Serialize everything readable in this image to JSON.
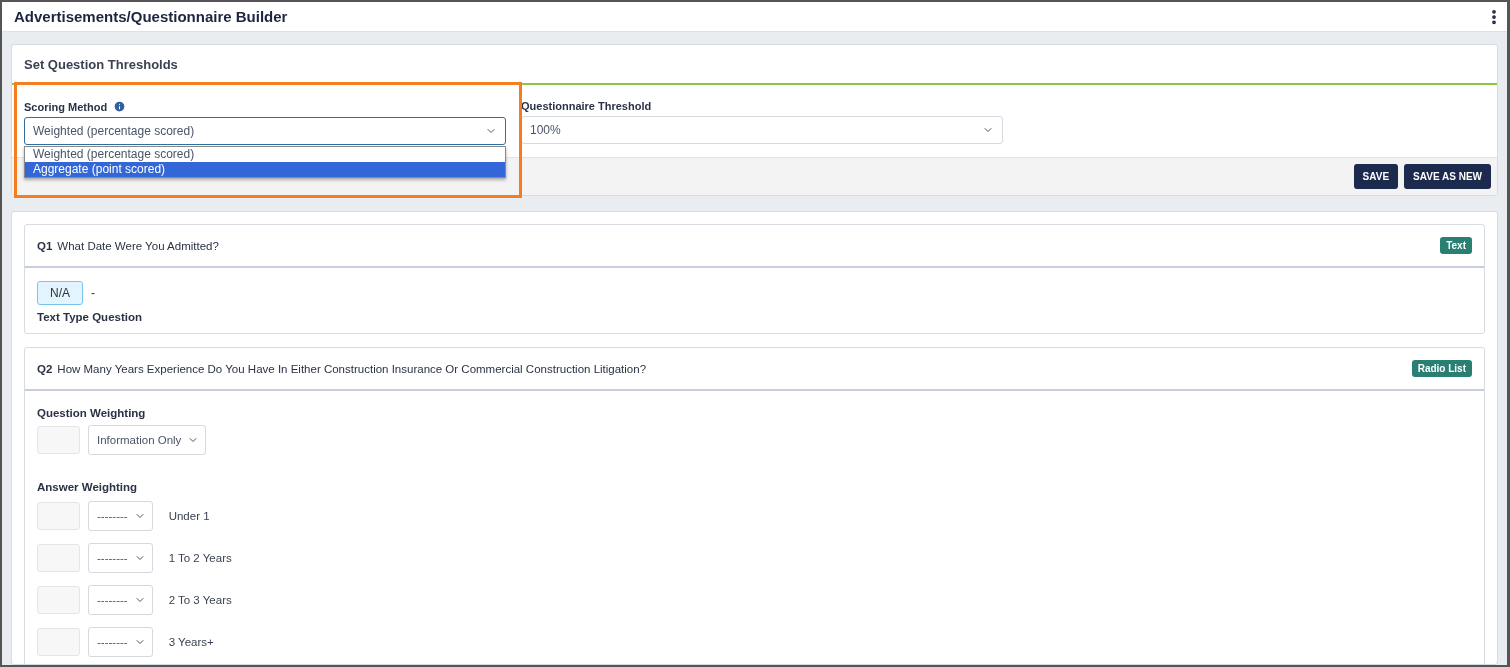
{
  "header": {
    "title": "Advertisements/Questionnaire Builder"
  },
  "thresholds": {
    "title": "Set Question Thresholds",
    "scoring": {
      "label": "Scoring Method",
      "value": "Weighted (percentage scored)",
      "expanded": true,
      "options": [
        {
          "label": "Weighted (percentage scored)",
          "highlighted": false
        },
        {
          "label": "Aggregate (point scored)",
          "highlighted": true
        }
      ]
    },
    "threshold": {
      "label": "Questionnaire Threshold",
      "value": "100%"
    },
    "buttons": [
      "SAVE",
      "SAVE AS NEW"
    ]
  },
  "questions": [
    {
      "kind": "text",
      "number": "Q1",
      "text": "What Date Were You Admitted?",
      "badge": "Text",
      "value": "N/A",
      "separator": "-",
      "caption": "Text Type Question"
    },
    {
      "kind": "radio",
      "number": "Q2",
      "text": "How Many Years Experience Do You Have In Either Construction Insurance Or Commercial Construction Litigation?",
      "badge": "Radio List",
      "question_weighting": {
        "label": "Question Weighting",
        "value": "Information Only"
      },
      "answer_weighting": {
        "label": "Answer Weighting",
        "answers": [
          {
            "value": "--------",
            "label": "Under 1"
          },
          {
            "value": "--------",
            "label": "1 To 2 Years"
          },
          {
            "value": "--------",
            "label": "2 To 3 Years"
          },
          {
            "value": "--------",
            "label": "3 Years+"
          }
        ]
      }
    }
  ]
}
